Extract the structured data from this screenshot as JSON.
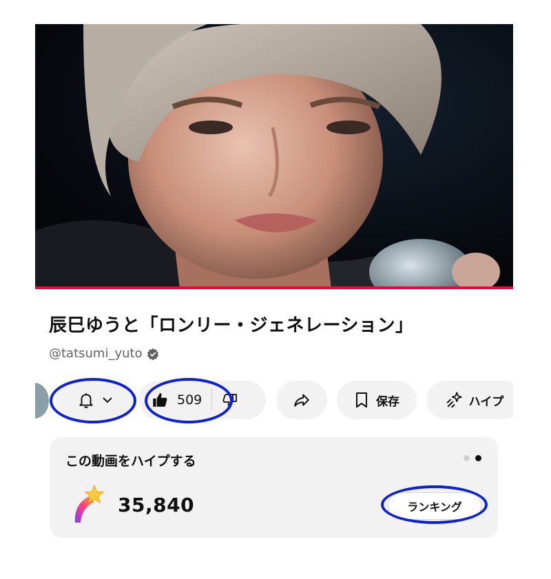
{
  "video": {
    "progress": 1.0
  },
  "details": {
    "title": "辰巳ゆうと「ロンリー・ジェネレーション」",
    "channel_handle": "@tatsumi_yuto",
    "verified_icon": "verified-icon"
  },
  "actions": {
    "subscribe_icon": "bell-icon",
    "like_count": "509",
    "save_label": "保存",
    "hype_label": "ハイプ"
  },
  "hype_card": {
    "title": "この動画をハイプする",
    "points": "35,840",
    "ranking_label": "ランキング",
    "carousel_pages": 2,
    "carousel_active": 2
  },
  "highlights": {
    "color": "#0a1fe0"
  },
  "colors": {
    "accent": "#ff0033",
    "pill_bg": "#f2f2f2",
    "text": "#0f0f0f",
    "secondary_text": "#606060"
  }
}
